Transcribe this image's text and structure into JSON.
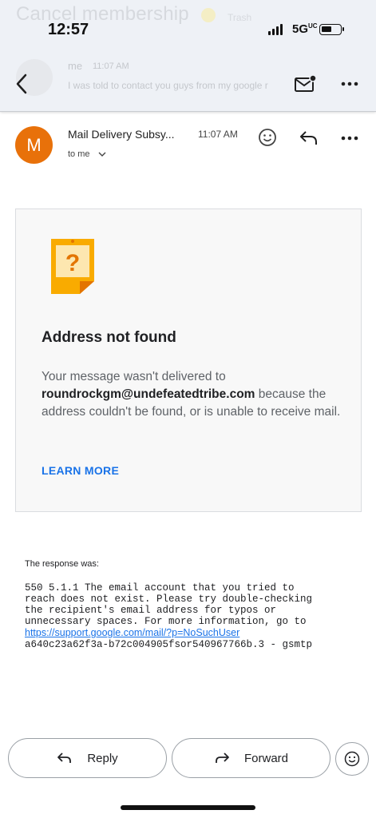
{
  "header": {
    "ghost_subject": "Cancel membership",
    "ghost_label": "Trash",
    "ghost_sender": "me",
    "ghost_time": "11:07 AM",
    "ghost_snippet": "I was told to contact you guys from my google r"
  },
  "status_bar": {
    "time": "12:57",
    "network": "5G",
    "network_suffix": "UC"
  },
  "message": {
    "avatar_letter": "M",
    "avatar_color": "#e8710a",
    "sender": "Mail Delivery Subsy...",
    "time": "11:07 AM",
    "recipient": "to me"
  },
  "card": {
    "title": "Address not found",
    "body_prefix": "Your message wasn't delivered to",
    "address": "roundrockgm@undefeatedtribe.com",
    "body_suffix": " because the address couldn't be found, or is unable to receive mail.",
    "learn_more": "LEARN MORE",
    "icon_color": "#f9ab00"
  },
  "response": {
    "label": "The response was:",
    "code_text": "550 5.1.1 The email account that you tried to\nreach does not exist. Please try double-checking\nthe recipient's email address for typos or\nunnecessary spaces. For more information, go to\n",
    "link": "https://support.google.com/mail/?p=NoSuchUser",
    "trailer": "\na640c23a62f3a-b72c004905fsor540967766b.3 - gsmtp"
  },
  "actions": {
    "reply_label": "Reply",
    "forward_label": "Forward"
  },
  "colors": {
    "accent_link": "#1a73e8"
  }
}
